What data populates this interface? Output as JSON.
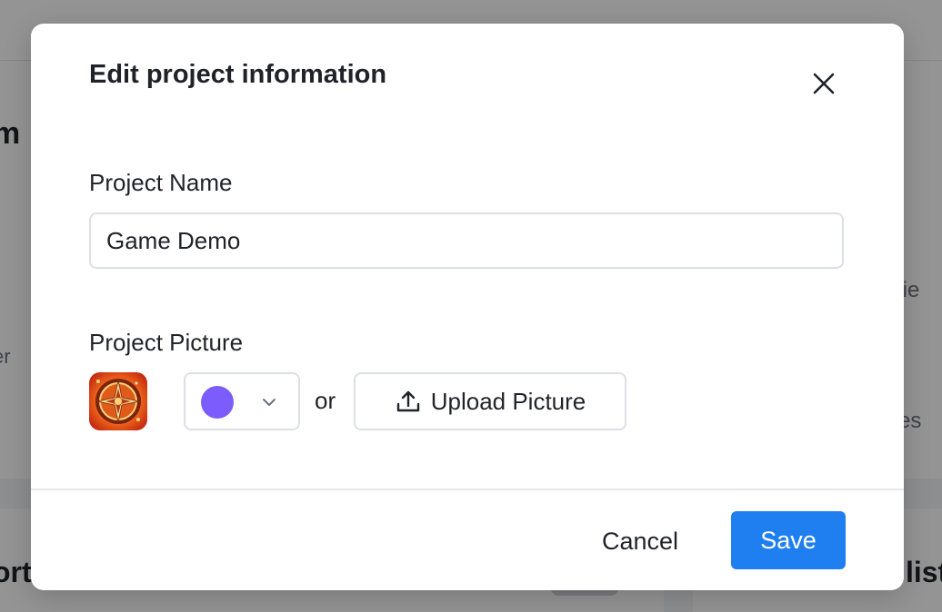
{
  "background": {
    "heading_fragment": "m",
    "left_fragment": "er",
    "right_fragment_1": "rtie",
    "right_fragment_2": "ties",
    "bottom_left_fragment": "ort",
    "bottom_right_fragment": "list"
  },
  "modal": {
    "title": "Edit project information",
    "close_icon": "close-icon",
    "project_name": {
      "label": "Project Name",
      "value": "Game Demo"
    },
    "project_picture": {
      "label": "Project Picture",
      "thumbnail_icon": "compass-game-icon",
      "color_select": {
        "selected_color": "#7c5cfc",
        "chevron_icon": "chevron-down-icon"
      },
      "or_text": "or",
      "upload_button": {
        "label": "Upload Picture",
        "icon": "upload-icon"
      }
    },
    "footer": {
      "cancel_label": "Cancel",
      "save_label": "Save"
    }
  },
  "colors": {
    "accent": "#1f7ff0",
    "text": "#1f2329",
    "border": "#dcdfe6"
  }
}
